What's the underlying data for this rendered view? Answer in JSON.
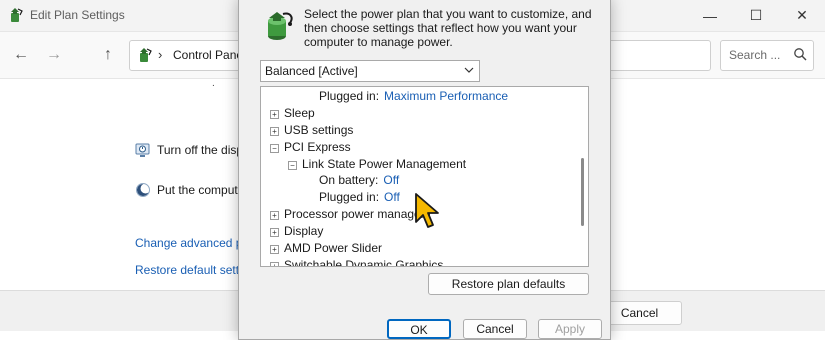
{
  "window": {
    "title": "Edit Plan Settings",
    "minimize_glyph": "—",
    "maximize_glyph": "☐",
    "close_glyph": "✕"
  },
  "nav": {
    "back_glyph": "←",
    "forward_glyph": "→",
    "up_glyph": "↑",
    "address_separator": "›",
    "address_text": "Control Panel",
    "search_placeholder": "Search ..."
  },
  "background": {
    "dot": ".",
    "row1_text": "Turn off the disp",
    "row2_text": "Put the compute",
    "link1": "Change advanced po",
    "link2": "Restore default setti",
    "cancel_label": "Cancel"
  },
  "dialog": {
    "description": "Select the power plan that you want to customize, and then choose settings that reflect how you want your computer to manage power.",
    "plan_selected": "Balanced [Active]",
    "tree": [
      {
        "label": "Plugged in:",
        "value": "Maximum Performance",
        "expander": ""
      },
      {
        "label": "Sleep",
        "value": "",
        "expander": "+"
      },
      {
        "label": "USB settings",
        "value": "",
        "expander": "+"
      },
      {
        "label": "PCI Express",
        "value": "",
        "expander": "−"
      },
      {
        "label": "Link State Power Management",
        "value": "",
        "expander": "−"
      },
      {
        "label": "On battery:",
        "value": "Off",
        "expander": ""
      },
      {
        "label": "Plugged in:",
        "value": "Off",
        "expander": ""
      },
      {
        "label": "Processor power managem",
        "value": "",
        "expander": "+"
      },
      {
        "label": "Display",
        "value": "",
        "expander": "+"
      },
      {
        "label": "AMD Power Slider",
        "value": "",
        "expander": "+"
      },
      {
        "label": "Switchable Dynamic Graphics",
        "value": "",
        "expander": "+"
      }
    ],
    "restore_label": "Restore plan defaults",
    "ok_label": "OK",
    "cancel_label": "Cancel",
    "apply_label": "Apply"
  },
  "colors": {
    "accent": "#0067c0",
    "link": "#1a5fb4",
    "cursor_fill": "#f5b800"
  }
}
